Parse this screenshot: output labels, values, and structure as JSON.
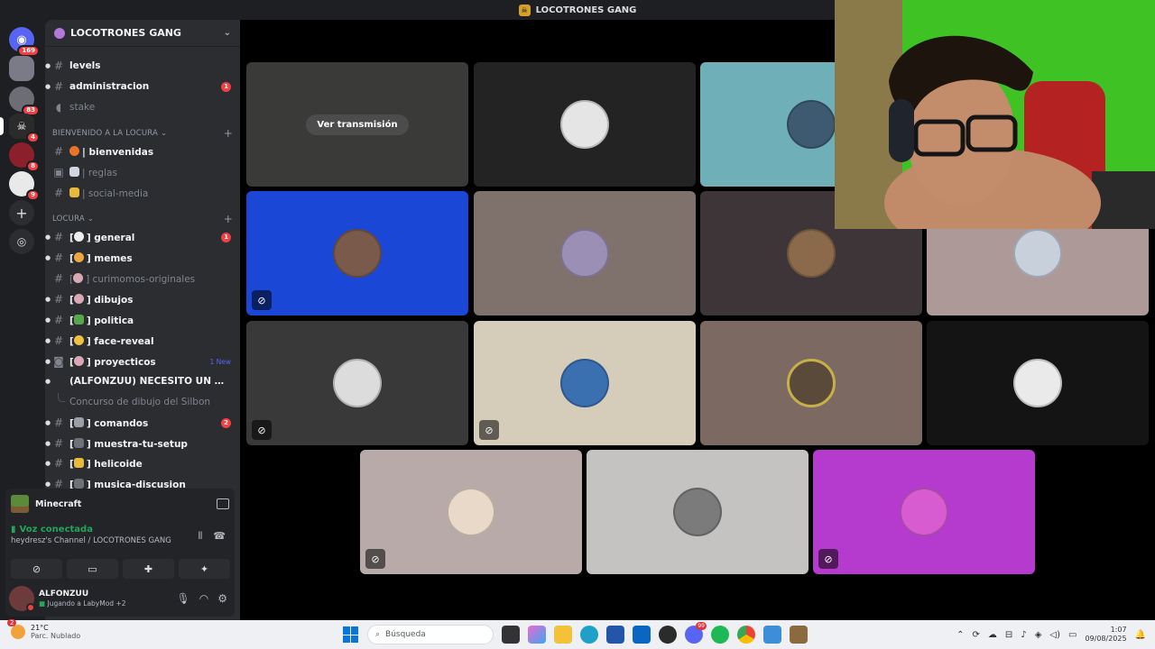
{
  "window": {
    "title": "LOCOTRONES GANG"
  },
  "rail": {
    "home_badge": "169",
    "servers": [
      {
        "badge": ""
      },
      {
        "badge": "83"
      },
      {
        "badge": "4"
      },
      {
        "badge": "8"
      },
      {
        "badge": "9"
      }
    ]
  },
  "server": {
    "name": "LOCOTRONES GANG"
  },
  "channels_top": [
    {
      "name": "levels",
      "badge": ""
    },
    {
      "name": "administracion",
      "badge": "1"
    },
    {
      "name": "stake",
      "badge": ""
    }
  ],
  "categories": {
    "cat1": "BIENVENIDO A LA LOCURA",
    "cat2": "LOCURA"
  },
  "channels_cat1": [
    {
      "name": "| bienvenidas"
    },
    {
      "name": "| reglas"
    },
    {
      "name": "| social-media"
    }
  ],
  "channels_cat2": [
    {
      "name": "general",
      "badge": "1"
    },
    {
      "name": "memes",
      "badge": ""
    },
    {
      "name": "curimomos-originales",
      "badge": ""
    },
    {
      "name": "dibujos",
      "badge": ""
    },
    {
      "name": "politica",
      "badge": ""
    },
    {
      "name": "face-reveal",
      "badge": ""
    },
    {
      "name": "proyecticos",
      "new": "1 New"
    },
    {
      "name": "(ALFONZUU) NECESITO UN BEATMAKER"
    },
    {
      "name": "Concurso de dibujo del Silbon"
    },
    {
      "name": "comandos",
      "badge": "2"
    },
    {
      "name": "muestra-tu-setup"
    },
    {
      "name": "helicoide"
    },
    {
      "name": "musica-discusion"
    }
  ],
  "activity": {
    "game": "Minecraft"
  },
  "voice": {
    "status": "Voz conectada",
    "channel": "heydresz's Channel / LOCOTRONES GANG"
  },
  "user": {
    "name": "ALFONZUU",
    "status": "Jugando a LabyMod",
    "extra": "+2"
  },
  "stage": {
    "stream_button": "Ver transmisión"
  },
  "colors": {
    "accent": "#5865f2",
    "voice_connected": "#23a55a",
    "mention_badge": "#f23f43",
    "webcam_greenscreen": "#3fc224"
  },
  "taskbar": {
    "weather_temp": "21°C",
    "weather_desc": "Parc. Nublado",
    "weather_badge": "2",
    "search_placeholder": "Búsqueda",
    "discord_badge": "99",
    "time": "1:07",
    "date": "09/08/2025"
  }
}
